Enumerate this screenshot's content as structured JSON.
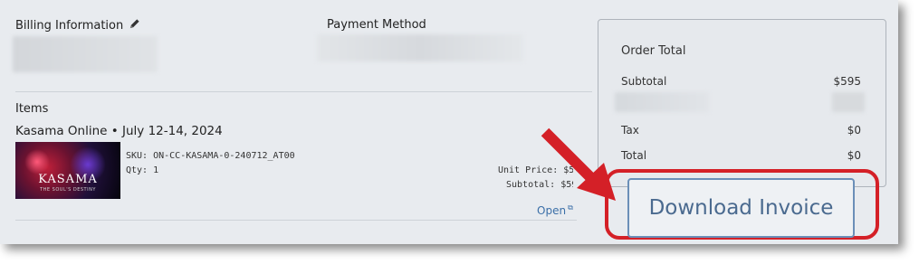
{
  "billing": {
    "title": "Billing Information"
  },
  "payment": {
    "title": "Payment Method"
  },
  "items": {
    "title": "Items",
    "product_name": "Kasama Online • July 12-14, 2024",
    "thumbnail": {
      "title": "KASAMA",
      "subtitle": "THE SOUL'S DESTINY"
    },
    "sku": "SKU: ON-CC-KASAMA-0-240712_AT00",
    "qty": "Qty: 1",
    "unit_price": "Unit Price: $595",
    "subtotal": "Subtotal: $595",
    "open_link": "Open"
  },
  "order_total": {
    "title": "Order Total",
    "subtotal_label": "Subtotal",
    "subtotal_value": "$595",
    "tax_label": "Tax",
    "tax_value": "$0",
    "total_label": "Total",
    "total_value": "$0"
  },
  "download_button": "Download Invoice",
  "colors": {
    "highlight": "#d42027",
    "button_border": "#6b8fb8",
    "link": "#3b6fa8"
  },
  "icons": [
    "pencil-icon",
    "external-link-icon",
    "arrow-annotation-icon"
  ]
}
